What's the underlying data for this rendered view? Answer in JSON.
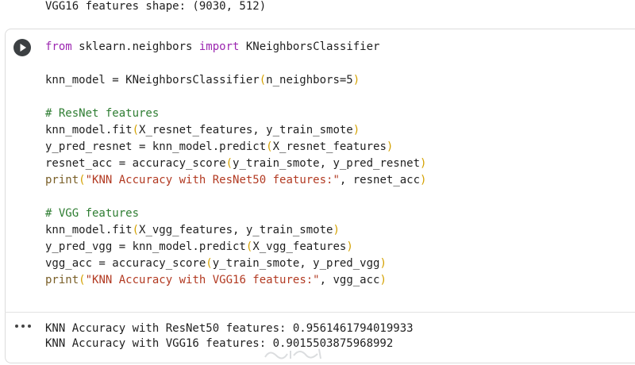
{
  "previous_output": {
    "text": "VGG16 features shape: (9030, 512)"
  },
  "cell": {
    "run_button_icon": "play-icon",
    "code_lines": [
      [
        {
          "t": "from",
          "c": "kw"
        },
        {
          "t": " sklearn.neighbors ",
          "c": ""
        },
        {
          "t": "import",
          "c": "kw"
        },
        {
          "t": " KNeighborsClassifier",
          "c": ""
        }
      ],
      [],
      [
        {
          "t": "knn_model = KNeighborsClassifier",
          "c": ""
        },
        {
          "t": "(",
          "c": "p1"
        },
        {
          "t": "n_neighbors=5",
          "c": ""
        },
        {
          "t": ")",
          "c": "p1"
        }
      ],
      [],
      [
        {
          "t": "# ResNet features",
          "c": "cmt"
        }
      ],
      [
        {
          "t": "knn_model.fit",
          "c": ""
        },
        {
          "t": "(",
          "c": "p1"
        },
        {
          "t": "X_resnet_features, y_train_smote",
          "c": ""
        },
        {
          "t": ")",
          "c": "p1"
        }
      ],
      [
        {
          "t": "y_pred_resnet = knn_model.predict",
          "c": ""
        },
        {
          "t": "(",
          "c": "p1"
        },
        {
          "t": "X_resnet_features",
          "c": ""
        },
        {
          "t": ")",
          "c": "p1"
        }
      ],
      [
        {
          "t": "resnet_acc = accuracy_score",
          "c": ""
        },
        {
          "t": "(",
          "c": "p1"
        },
        {
          "t": "y_train_smote, y_pred_resnet",
          "c": ""
        },
        {
          "t": ")",
          "c": "p1"
        }
      ],
      [
        {
          "t": "print",
          "c": "fn"
        },
        {
          "t": "(",
          "c": "p1"
        },
        {
          "t": "\"KNN Accuracy with ResNet50 features:\"",
          "c": "str"
        },
        {
          "t": ", resnet_acc",
          "c": ""
        },
        {
          "t": ")",
          "c": "p1"
        }
      ],
      [],
      [
        {
          "t": "# VGG features",
          "c": "cmt"
        }
      ],
      [
        {
          "t": "knn_model.fit",
          "c": ""
        },
        {
          "t": "(",
          "c": "p1"
        },
        {
          "t": "X_vgg_features, y_train_smote",
          "c": ""
        },
        {
          "t": ")",
          "c": "p1"
        }
      ],
      [
        {
          "t": "y_pred_vgg = knn_model.predict",
          "c": ""
        },
        {
          "t": "(",
          "c": "p1"
        },
        {
          "t": "X_vgg_features",
          "c": ""
        },
        {
          "t": ")",
          "c": "p1"
        }
      ],
      [
        {
          "t": "vgg_acc = accuracy_score",
          "c": ""
        },
        {
          "t": "(",
          "c": "p1"
        },
        {
          "t": "y_train_smote, y_pred_vgg",
          "c": ""
        },
        {
          "t": ")",
          "c": "p1"
        }
      ],
      [
        {
          "t": "print",
          "c": "fn"
        },
        {
          "t": "(",
          "c": "p1"
        },
        {
          "t": "\"KNN Accuracy with VGG16 features:\"",
          "c": "str"
        },
        {
          "t": ", vgg_acc",
          "c": ""
        },
        {
          "t": ")",
          "c": "p1"
        }
      ]
    ]
  },
  "output": {
    "menu_icon": "more-horiz-icon",
    "lines": [
      "KNN Accuracy with ResNet50 features: 0.9561461794019933",
      "KNN Accuracy with VGG16 features: 0.9015503875968992"
    ]
  },
  "colors": {
    "keyword": "#9c27b0",
    "comment": "#2e7d32",
    "string": "#b23a22",
    "paren": "#d4a100",
    "function": "#795e26"
  }
}
